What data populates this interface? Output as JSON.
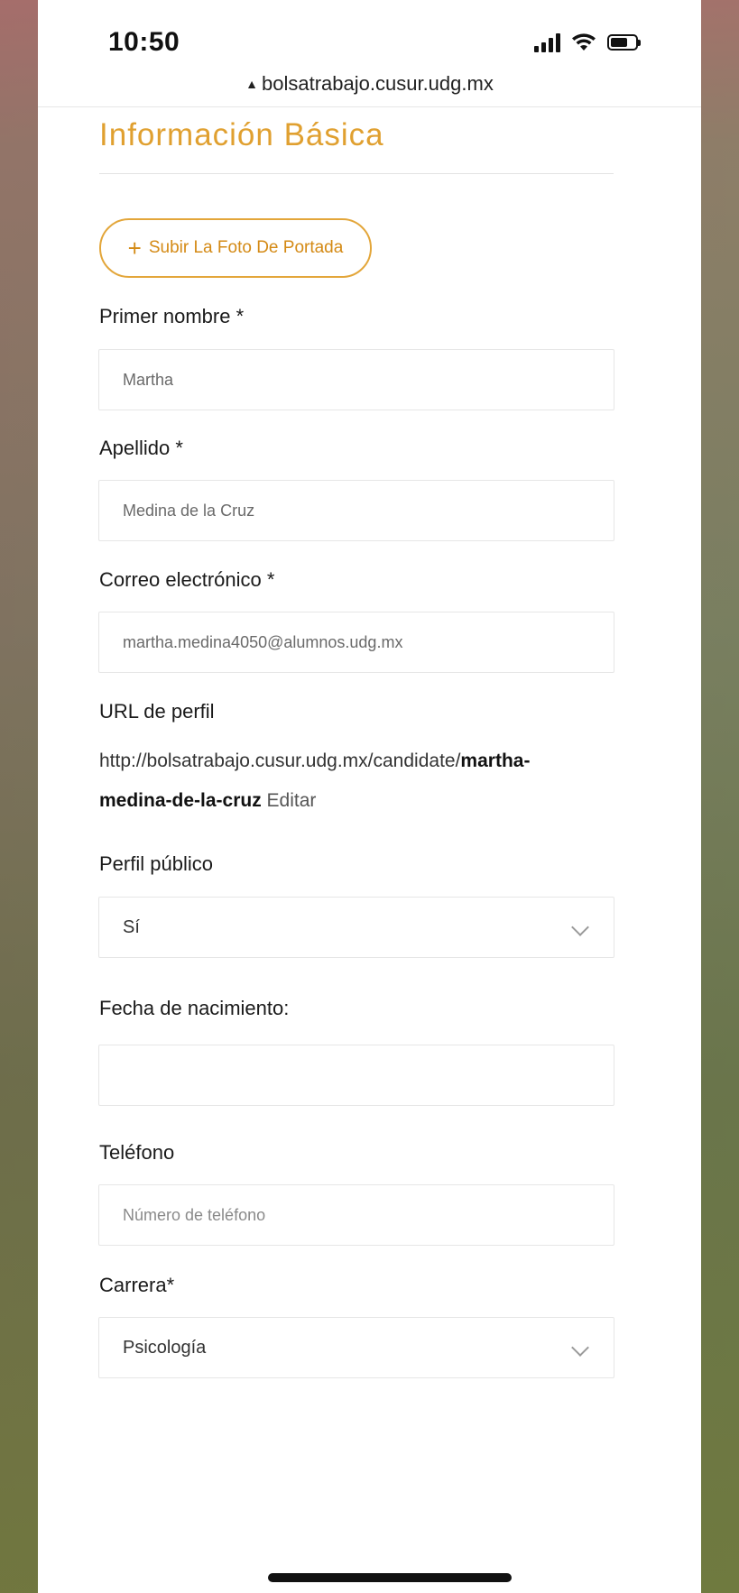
{
  "status": {
    "time": "10:50"
  },
  "browser": {
    "url": "bolsatrabajo.cusur.udg.mx"
  },
  "section": {
    "title": "Información Básica"
  },
  "upload": {
    "label": "Subir La Foto De Portada"
  },
  "form": {
    "first_name": {
      "label": "Primer nombre *",
      "value": "Martha"
    },
    "last_name": {
      "label": "Apellido *",
      "value": "Medina de la Cruz"
    },
    "email": {
      "label": "Correo electrónico *",
      "value": "martha.medina4050@alumnos.udg.mx"
    },
    "profile_url": {
      "label": "URL de perfil",
      "prefix": "http://bolsatrabajo.cusur.udg.mx/candidate/",
      "slug_part1": "martha-",
      "slug_part2": "medina-de-la-cruz",
      "edit_label": "Editar"
    },
    "public_profile": {
      "label": "Perfil público",
      "value": "Sí"
    },
    "birth_date": {
      "label": "Fecha de nacimiento:",
      "value": ""
    },
    "phone": {
      "label": "Teléfono",
      "placeholder": "Número de teléfono"
    },
    "career": {
      "label": "Carrera*",
      "value": "Psicología"
    }
  }
}
